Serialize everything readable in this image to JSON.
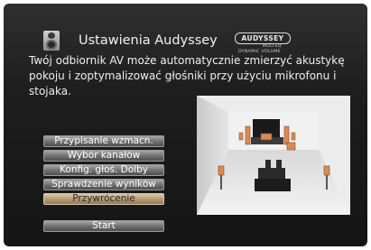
{
  "header": {
    "title": "Ustawienia Audyssey",
    "title_icon": "speaker-icon"
  },
  "logo": {
    "brand": "AUDYSSEY",
    "line2": "MULTEQ",
    "line3": "DYNAMIC VOLUME"
  },
  "description": [
    "Twój odbiornik AV może automatycznie zmierzyć akustykę",
    "pokoju i zoptymalizować głośniki przy użyciu mikrofonu i",
    "stojaka."
  ],
  "menu": {
    "items": [
      {
        "label": "Przypisanie wzmacn."
      },
      {
        "label": "Wybór kanałów"
      },
      {
        "label": "Konfig. głoś. Dolby"
      },
      {
        "label": "Sprawdzenie wyników"
      },
      {
        "label": "Przywrócenie"
      }
    ],
    "selected_index": 4,
    "start_label": "Start"
  },
  "colors": {
    "background": "#1d1d1d",
    "button": "#7a7a7a",
    "button_selected": "#b39a72",
    "text": "#f0f0f0"
  }
}
